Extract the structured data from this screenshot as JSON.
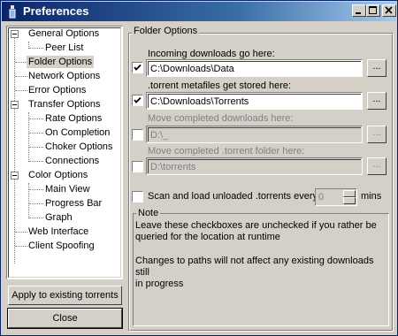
{
  "window": {
    "title": "Preferences"
  },
  "tree": {
    "items": [
      {
        "label": "General Options"
      },
      {
        "label": "Peer List"
      },
      {
        "label": "Folder Options"
      },
      {
        "label": "Network Options"
      },
      {
        "label": "Error Options"
      },
      {
        "label": "Transfer Options"
      },
      {
        "label": "Rate Options"
      },
      {
        "label": "On Completion"
      },
      {
        "label": "Choker Options"
      },
      {
        "label": "Connections"
      },
      {
        "label": "Color Options"
      },
      {
        "label": "Main View"
      },
      {
        "label": "Progress Bar"
      },
      {
        "label": "Graph"
      },
      {
        "label": "Web Interface"
      },
      {
        "label": "Client Spoofing"
      }
    ],
    "selected": "Folder Options"
  },
  "buttons": {
    "apply_label": "Apply to existing torrents",
    "close_label": "Close"
  },
  "folder_options": {
    "group_title": "Folder Options",
    "incoming": {
      "label": "Incoming downloads go here:",
      "checked": true,
      "value": "C:\\Downloads\\Data",
      "browse": "..."
    },
    "metafiles": {
      "label": ".torrent metafiles get stored here:",
      "checked": true,
      "value": "C:\\Downloads\\Torrents",
      "browse": "..."
    },
    "move_completed": {
      "label": "Move completed downloads here:",
      "checked": false,
      "value": "D:\\_",
      "browse": "..."
    },
    "move_torrent": {
      "label": "Move completed .torrent folder here:",
      "checked": false,
      "value": "D:\\torrents",
      "browse": "..."
    },
    "scan": {
      "label": "Scan and load unloaded .torrents every",
      "checked": false,
      "value": "0",
      "unit": "mins"
    }
  },
  "note": {
    "title": "Note",
    "line1": "Leave these checkboxes are unchecked if you rather be\nqueried for the location at runtime",
    "line2": "Changes to paths will not affect any existing downloads still\nin progress"
  }
}
